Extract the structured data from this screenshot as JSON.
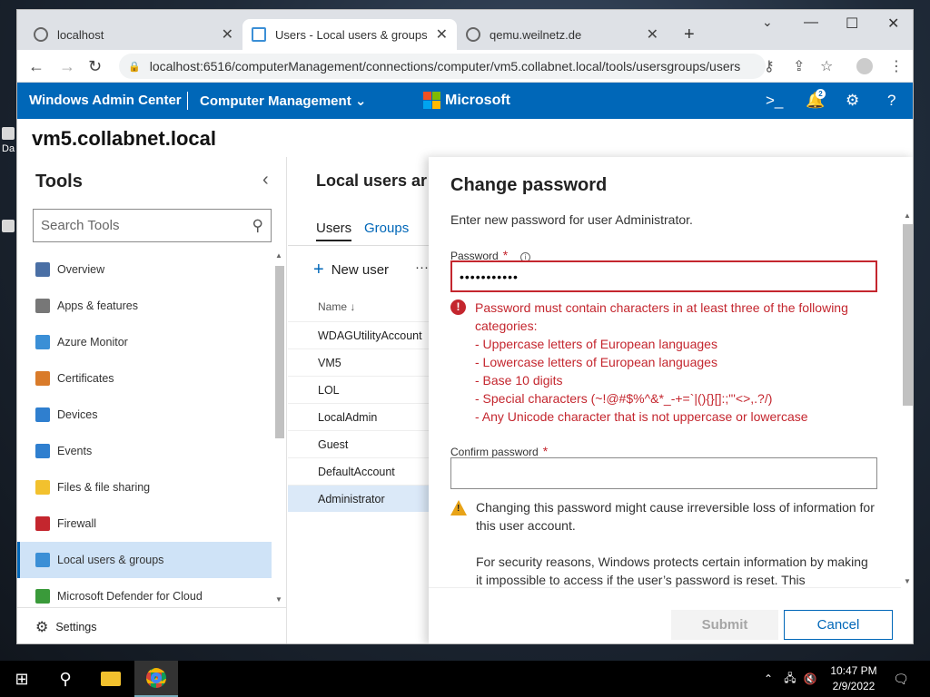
{
  "browser": {
    "tabs": [
      {
        "title": "localhost",
        "active": false
      },
      {
        "title": "Users - Local users & groups - C",
        "active": true
      },
      {
        "title": "qemu.weilnetz.de",
        "active": false
      }
    ],
    "url": "localhost:6516/computerManagement/connections/computer/vm5.collabnet.local/tools/usersgroups/users"
  },
  "header": {
    "app_title": "Windows Admin Center",
    "context": "Computer Management",
    "brand": "Microsoft",
    "notification_count": "2",
    "accent_color": "#0067b8"
  },
  "server_name": "vm5.collabnet.local",
  "tools": {
    "title": "Tools",
    "search_placeholder": "Search Tools",
    "items": [
      {
        "label": "Overview",
        "icon": "monitor-icon",
        "color": "#4a6fa5"
      },
      {
        "label": "Apps & features",
        "icon": "list-icon",
        "color": "#777"
      },
      {
        "label": "Azure Monitor",
        "icon": "gauge-icon",
        "color": "#3b8fd6"
      },
      {
        "label": "Certificates",
        "icon": "certificate-icon",
        "color": "#d97b2a"
      },
      {
        "label": "Devices",
        "icon": "devices-icon",
        "color": "#2f7fcf"
      },
      {
        "label": "Events",
        "icon": "events-icon",
        "color": "#2f7fcf"
      },
      {
        "label": "Files & file sharing",
        "icon": "folder-icon",
        "color": "#f2c12e"
      },
      {
        "label": "Firewall",
        "icon": "firewall-icon",
        "color": "#c4262e"
      },
      {
        "label": "Local users & groups",
        "icon": "users-icon",
        "color": "#3b8fd6",
        "selected": true
      },
      {
        "label": "Microsoft Defender for Cloud",
        "icon": "shield-icon",
        "color": "#3a9a3a"
      }
    ],
    "settings_label": "Settings"
  },
  "main": {
    "title": "Local users ar",
    "tabs": [
      "Users",
      "Groups"
    ],
    "new_user_label": "New user",
    "more_label": "···",
    "name_header": "Name ↓",
    "users": [
      "WDAGUtilityAccount",
      "VM5",
      "LOL",
      "LocalAdmin",
      "Guest",
      "DefaultAccount",
      "Administrator"
    ]
  },
  "dialog": {
    "title": "Change password",
    "description": "Enter new password for user Administrator.",
    "password_label": "Password",
    "password_value": "•••••••••••",
    "error_lines": [
      "Password must contain characters in at least three of the following categories:",
      "- Uppercase letters of European languages",
      "- Lowercase letters of European languages",
      "- Base 10 digits",
      "- Special characters (~!@#$%^&*_-+=`|(){}[]:;\"'<>,.?/)",
      "- Any Unicode character that is not uppercase or lowercase"
    ],
    "confirm_label": "Confirm password",
    "confirm_value": "",
    "warning_1": "Changing this password might cause irreversible loss of information for this user account.",
    "warning_2": "For security reasons, Windows protects certain information by making it impossible to access if the user’s password is reset. This",
    "submit_label": "Submit",
    "cancel_label": "Cancel",
    "error_color": "#c4262e"
  },
  "taskbar": {
    "time": "10:47 PM",
    "date": "2/9/2022"
  }
}
